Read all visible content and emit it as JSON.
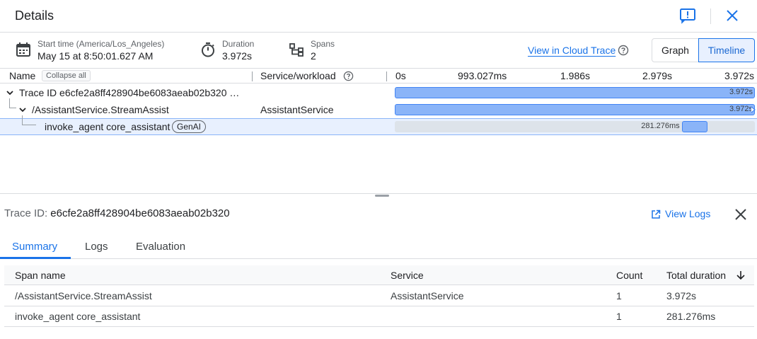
{
  "header": {
    "title": "Details"
  },
  "meta": {
    "start_time_label": "Start time (America/Los_Angeles)",
    "start_time_value": "May 15 at 8:50:01.627 AM",
    "duration_label": "Duration",
    "duration_value": "3.972s",
    "spans_label": "Spans",
    "spans_value": "2",
    "cloud_trace_link": "View in Cloud Trace",
    "view_graph": "Graph",
    "view_timeline": "Timeline",
    "selected_view": "Timeline"
  },
  "tree_table": {
    "col_name": "Name",
    "collapse_all": "Collapse all",
    "col_service": "Service/workload",
    "ticks": [
      "0s",
      "993.027ms",
      "1.986s",
      "2.979s",
      "3.972s"
    ],
    "rows": [
      {
        "name": "Trace ID e6cfe2a8ff428904be6083aeab02b320 …",
        "service": "",
        "duration": "3.972s",
        "start_fraction": 0.0,
        "duration_fraction": 1.0
      },
      {
        "name": "/AssistantService.StreamAssist",
        "service": "AssistantService",
        "duration": "3.972s",
        "start_fraction": 0.0,
        "duration_fraction": 1.0
      },
      {
        "name": "invoke_agent core_assistant",
        "badge": "GenAI",
        "service": "",
        "duration": "281.276ms",
        "start_fraction": 0.797,
        "duration_fraction": 0.0708
      }
    ]
  },
  "detail": {
    "trace_id_label": "Trace ID:",
    "trace_id_value": "e6cfe2a8ff428904be6083aeab02b320",
    "view_logs": "View Logs",
    "tabs": [
      "Summary",
      "Logs",
      "Evaluation"
    ],
    "active_tab": "Summary",
    "summary": {
      "headers": [
        "Span name",
        "Service",
        "Count",
        "Total duration"
      ],
      "rows": [
        [
          "/AssistantService.StreamAssist",
          "AssistantService",
          "1",
          "3.972s"
        ],
        [
          "invoke_agent core_assistant",
          "",
          "1",
          "281.276ms"
        ]
      ]
    }
  },
  "colors": {
    "accent": "#1a73e8",
    "bar_fill": "#8ab4f8",
    "bar_border": "#4285f4",
    "selected_row": "#e8f0fe"
  },
  "icons": {
    "feedback": "feedback-icon",
    "close": "close-icon",
    "calendar": "calendar-icon",
    "timer": "timer-icon",
    "spans": "spans-tree-icon",
    "help": "help-icon",
    "open_in_new": "open-in-new-icon",
    "sort": "arrow-down-icon"
  }
}
